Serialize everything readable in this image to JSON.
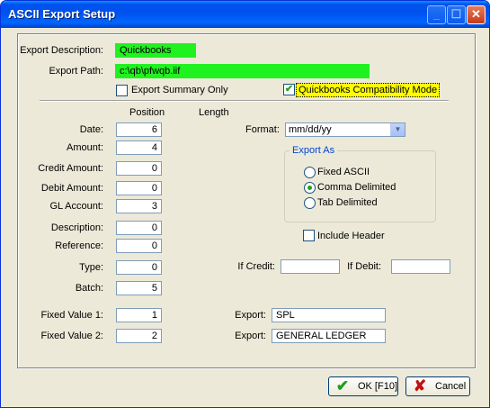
{
  "window": {
    "title": "ASCII Export Setup"
  },
  "controls": {
    "minimize": "_",
    "maximize": "☐",
    "close": "✕"
  },
  "export_description": {
    "label": "Export Description:",
    "value": "Quickbooks"
  },
  "export_path": {
    "label": "Export Path:",
    "value": "c:\\qb\\pfwqb.iif"
  },
  "export_summary_only": {
    "label": "Export Summary Only",
    "checked": false,
    "mark": ""
  },
  "qb_compat": {
    "label": "Quickbooks Compatibility Mode",
    "checked": true,
    "mark": "✔"
  },
  "headers": {
    "position": "Position",
    "length": "Length"
  },
  "fields": [
    {
      "label": "Date:",
      "value": "6"
    },
    {
      "label": "Amount:",
      "value": "4"
    },
    {
      "label": "Credit Amount:",
      "value": "0"
    },
    {
      "label": "Debit Amount:",
      "value": "0"
    },
    {
      "label": "GL Account:",
      "value": "3"
    },
    {
      "label": "Description:",
      "value": "0"
    },
    {
      "label": "Reference:",
      "value": "0"
    },
    {
      "label": "Type:",
      "value": "0"
    },
    {
      "label": "Batch:",
      "value": "5"
    }
  ],
  "format": {
    "label": "Format:",
    "value": "mm/dd/yy"
  },
  "export_as": {
    "label": "Export As",
    "options": [
      {
        "label": "Fixed ASCII",
        "selected": false
      },
      {
        "label": "Comma Delimited",
        "selected": true
      },
      {
        "label": "Tab Delimited",
        "selected": false
      }
    ]
  },
  "include_header": {
    "label": "Include Header",
    "checked": false,
    "mark": ""
  },
  "if_credit": {
    "label": "If Credit:",
    "value": ""
  },
  "if_debit": {
    "label": "If Debit:",
    "value": ""
  },
  "fixed_values": [
    {
      "label": "Fixed Value 1:",
      "value": "1",
      "export_label": "Export:",
      "export_value": "SPL"
    },
    {
      "label": "Fixed Value 2:",
      "value": "2",
      "export_label": "Export:",
      "export_value": "GENERAL LEDGER"
    }
  ],
  "buttons": {
    "ok": {
      "label": "OK  [F10]",
      "icon": "✔",
      "icon_color": "#1e9e1e"
    },
    "cancel": {
      "label": "Cancel",
      "icon": "✘",
      "icon_color": "#c01010"
    }
  }
}
